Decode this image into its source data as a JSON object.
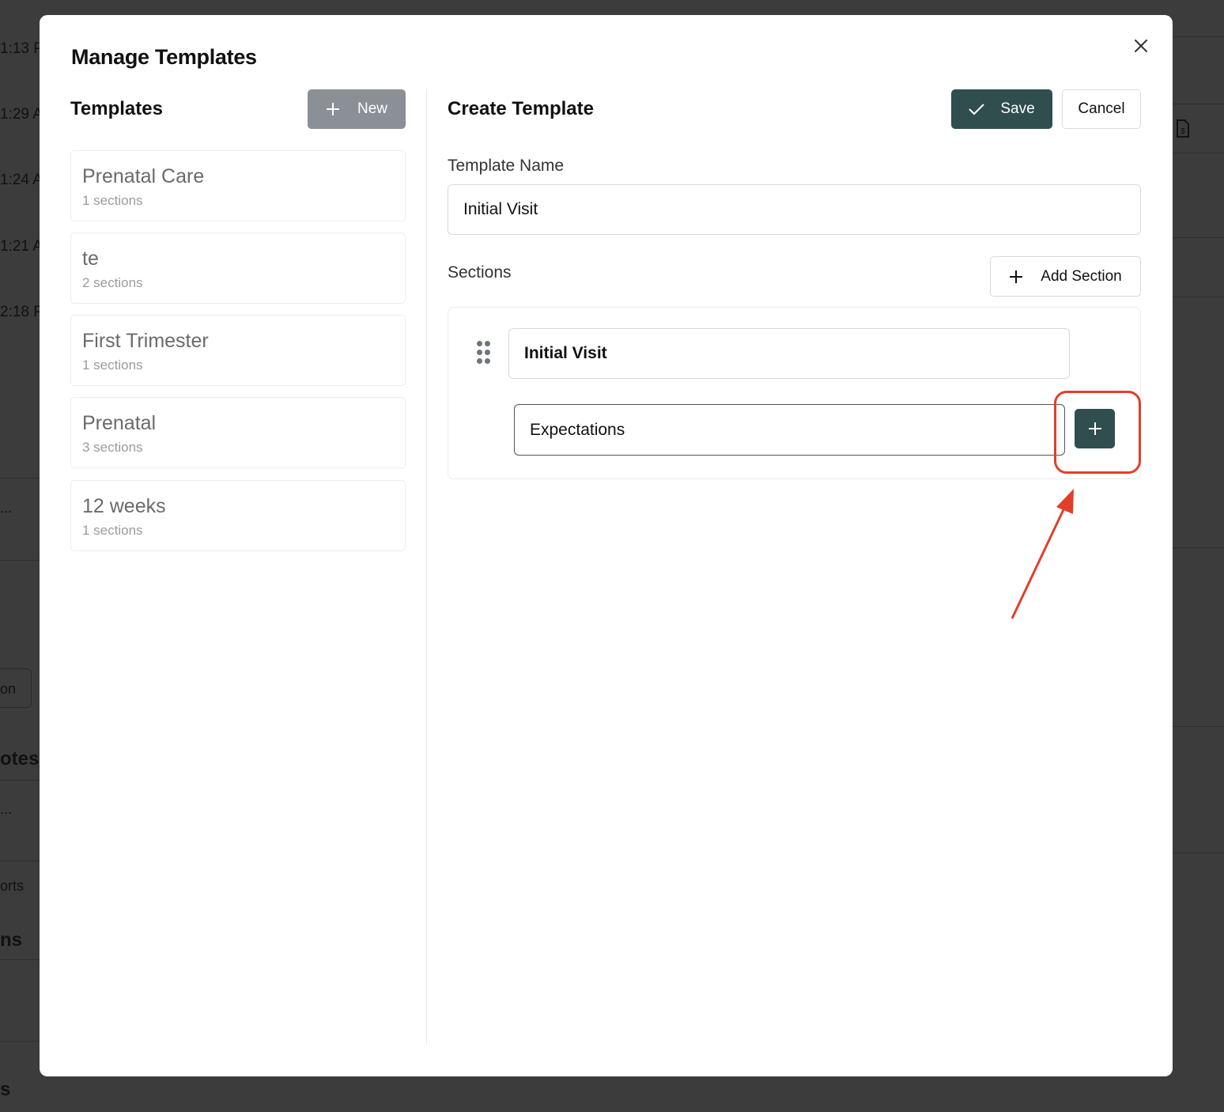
{
  "background": {
    "times": [
      "1:13 P",
      "1:29 A",
      "1:24 A",
      "1:21 A",
      "2:18 P"
    ],
    "fragments": [
      ":",
      "...",
      "on",
      "otes",
      "...",
      "orts",
      "ns",
      "s"
    ]
  },
  "modal": {
    "title": "Manage Templates",
    "close_icon": "close-icon"
  },
  "templates_pane": {
    "heading": "Templates",
    "new_button": "New",
    "items": [
      {
        "name": "Prenatal Care",
        "count": "1 sections"
      },
      {
        "name": "te",
        "count": "2 sections"
      },
      {
        "name": "First Trimester",
        "count": "1 sections"
      },
      {
        "name": "Prenatal",
        "count": "3 sections"
      },
      {
        "name": "12 weeks",
        "count": "1 sections"
      }
    ]
  },
  "editor": {
    "heading": "Create Template",
    "save_button": "Save",
    "cancel_button": "Cancel",
    "template_name_label": "Template Name",
    "template_name_value": "Initial Visit",
    "sections_label": "Sections",
    "add_section_button": "Add Section",
    "section": {
      "title_value": "Initial Visit",
      "item_value": "Expectations"
    }
  },
  "colors": {
    "primary": "#2f4e4d",
    "new_button": "#8b8f96",
    "annotation": "#e0402a"
  }
}
